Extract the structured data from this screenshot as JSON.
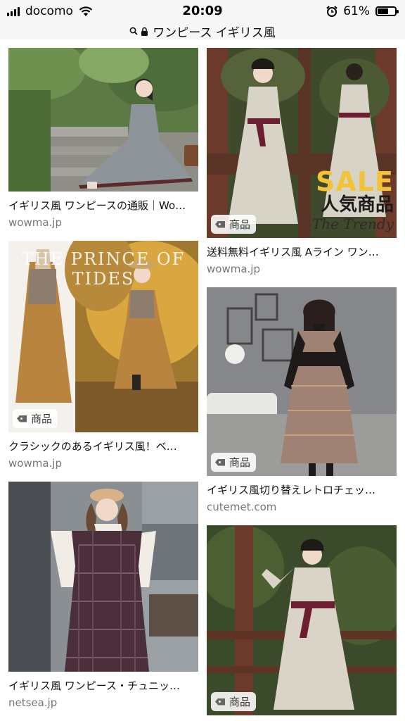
{
  "status_bar": {
    "carrier": "docomo",
    "time": "20:09",
    "battery_percent": "61%",
    "battery_level": 0.61
  },
  "url_bar": {
    "query": "ワンピース イギリス風"
  },
  "results": {
    "left": [
      {
        "title": "イギリス風 ワンピースの通販｜Wo…",
        "source": "wowma.jp",
        "has_badge": false
      },
      {
        "title": "クラシックのあるイギリス風！ベ…",
        "source": "wowma.jp",
        "badge": "商品",
        "banner_text": "THE PRINCE OF TIDES"
      },
      {
        "title": "イギリス風 ワンピース・チュニッ…",
        "source": "netsea.jp",
        "has_badge": false
      }
    ],
    "right": [
      {
        "title": "送料無料イギリス風 Aライン ワン…",
        "source": "wowma.jp",
        "badge": "商品",
        "sale": {
          "big": "SALE",
          "mid": "人気商品",
          "small": "The Trendy"
        }
      },
      {
        "title": "イギリス風切り替えレトロチェッ…",
        "source": "cutemet.com",
        "badge": "商品"
      },
      {
        "badge": "商品"
      }
    ]
  },
  "colors": {
    "status_bar_bg": "#f7f7f7",
    "source_text": "#777777",
    "title_text": "#111111",
    "sale_yellow": "#f2c335"
  },
  "icons": [
    "signal-icon",
    "wifi-icon",
    "search-icon",
    "lock-icon",
    "alarm-icon",
    "battery-icon",
    "tag-icon"
  ]
}
